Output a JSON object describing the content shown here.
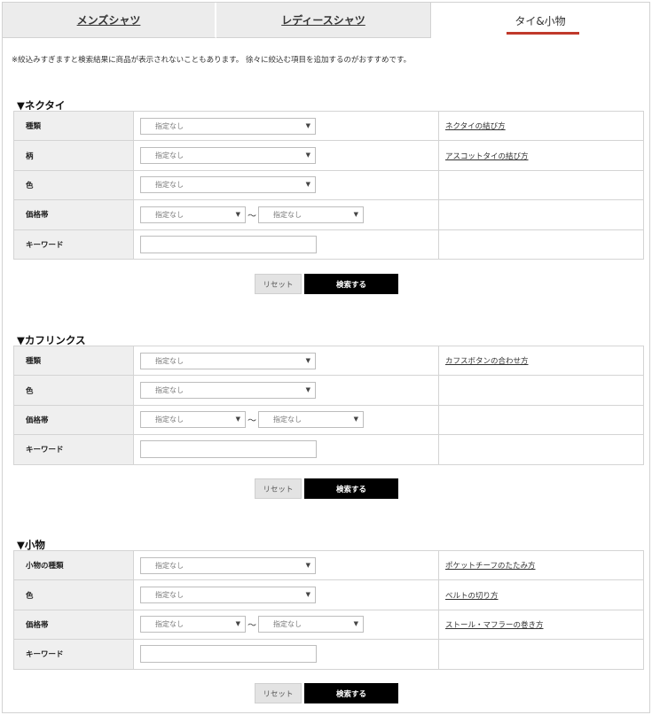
{
  "tabs": [
    {
      "label": "メンズシャツ"
    },
    {
      "label": "レディースシャツ"
    },
    {
      "label": "タイ&小物"
    }
  ],
  "notice": "※絞込みすぎますと検索結果に商品が表示されないこともあります。 徐々に絞込む項目を追加するのがおすすめです。",
  "common": {
    "select_default": "指定なし",
    "range_separator": "～",
    "reset_label": "リセット",
    "search_label": "検索する"
  },
  "sections": [
    {
      "title": "▼ネクタイ",
      "rows": [
        {
          "label": "種類",
          "link": "ネクタイの結び方"
        },
        {
          "label": "柄",
          "link": "アスコットタイの結び方"
        },
        {
          "label": "色",
          "link": ""
        },
        {
          "label": "価格帯",
          "link": ""
        },
        {
          "label": "キーワード",
          "link": ""
        }
      ]
    },
    {
      "title": "▼カフリンクス",
      "rows": [
        {
          "label": "種類",
          "link": "カフスボタンの合わせ方"
        },
        {
          "label": "色",
          "link": ""
        },
        {
          "label": "価格帯",
          "link": ""
        },
        {
          "label": "キーワード",
          "link": ""
        }
      ]
    },
    {
      "title": "▼小物",
      "rows": [
        {
          "label": "小物の種類",
          "link": "ポケットチーフのたたみ方"
        },
        {
          "label": "色",
          "link": "ベルトの切り方"
        },
        {
          "label": "価格帯",
          "link": "ストール・マフラーの巻き方"
        },
        {
          "label": "キーワード",
          "link": ""
        }
      ]
    }
  ]
}
